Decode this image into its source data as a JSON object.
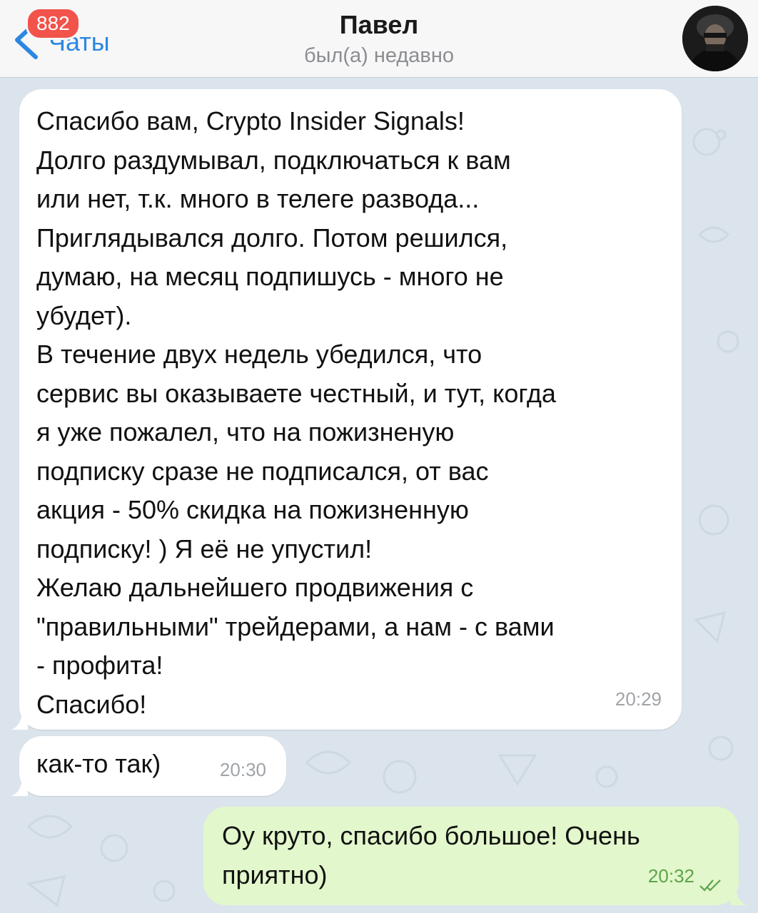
{
  "header": {
    "back_label": "Чаты",
    "unread_badge": "882",
    "contact_name": "Павел",
    "status": "был(а) недавно",
    "accent_color": "#2c87e0"
  },
  "messages": [
    {
      "direction": "incoming",
      "text": "Спасибо вам, Crypto Insider Signals!\nДолго раздумывал, подключаться к вам\nили нет, т.к. много в телеге развода...\nПриглядывался долго. Потом решился,\nдумаю, на месяц подпишусь - много не\nубудет).\nВ течение двух недель убедился, что\nсервис вы оказываете честный, и тут, когда\nя уже пожалел, что на пожизненую\nподписку сразе не подписался, от вас\nакция - 50% скидка на пожизненную\nподписку! ) Я её не упустил!\nЖелаю дальнейшего продвижения с\n\"правильными\" трейдерами, а нам - с вами\n- профита!\nСпасибо!",
      "time": "20:29"
    },
    {
      "direction": "incoming",
      "text": "как-то так)",
      "time": "20:30"
    },
    {
      "direction": "outgoing",
      "text": "Оу круто, спасибо большое! Очень\nприятно)",
      "time": "20:32",
      "read_status": "double-check-icon"
    }
  ]
}
